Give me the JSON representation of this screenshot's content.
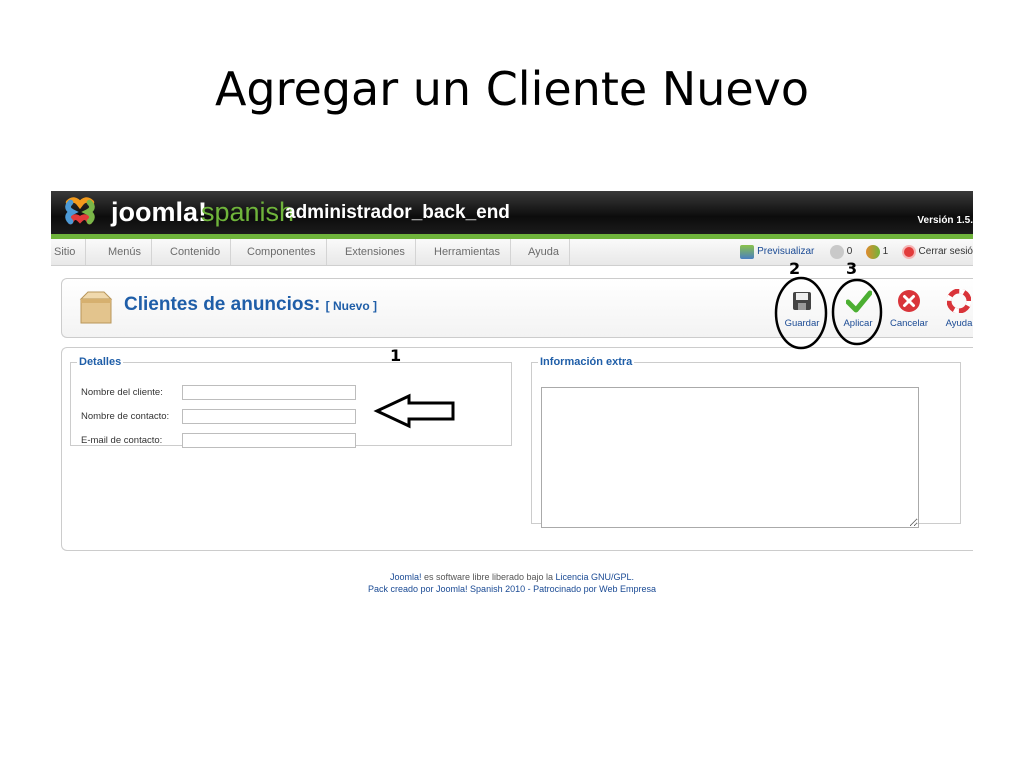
{
  "slide": {
    "title": "Agregar un Cliente Nuevo"
  },
  "header": {
    "brand": "joomla!",
    "brand_sub": "spanish",
    "admin_title": "administrador_back_end",
    "version": "Versión 1.5."
  },
  "menu": {
    "items": [
      "Sitio",
      "Menús",
      "Contenido",
      "Componentes",
      "Extensiones",
      "Herramientas",
      "Ayuda"
    ]
  },
  "status": {
    "preview": "Previsualizar",
    "messages_count": "0",
    "users_count": "1",
    "logout": "Cerrar sesió"
  },
  "toolbar": {
    "heading": "Clientes de anuncios:",
    "subheading": "[ Nuevo ]",
    "buttons": {
      "save": "Guardar",
      "apply": "Aplicar",
      "cancel": "Cancelar",
      "help": "Ayuda"
    }
  },
  "details": {
    "legend": "Detalles",
    "fields": [
      {
        "label": "Nombre del cliente:",
        "value": ""
      },
      {
        "label": "Nombre de contacto:",
        "value": ""
      },
      {
        "label": "E-mail de contacto:",
        "value": ""
      }
    ]
  },
  "extra": {
    "legend": "Información extra",
    "value": ""
  },
  "footer": {
    "line1_link": "Joomla!",
    "line1_text": " es software libre liberado bajo la ",
    "line1_link2": "Licencia GNU/GPL.",
    "line2": "Pack creado por Joomla! Spanish 2010 - Patrocinado por Web Empresa"
  },
  "annotations": {
    "one": "1",
    "two": "2",
    "three": "3"
  },
  "colors": {
    "accent_blue": "#1f5ea8",
    "header_green": "#6fb43b",
    "header_dark": "#111111"
  }
}
